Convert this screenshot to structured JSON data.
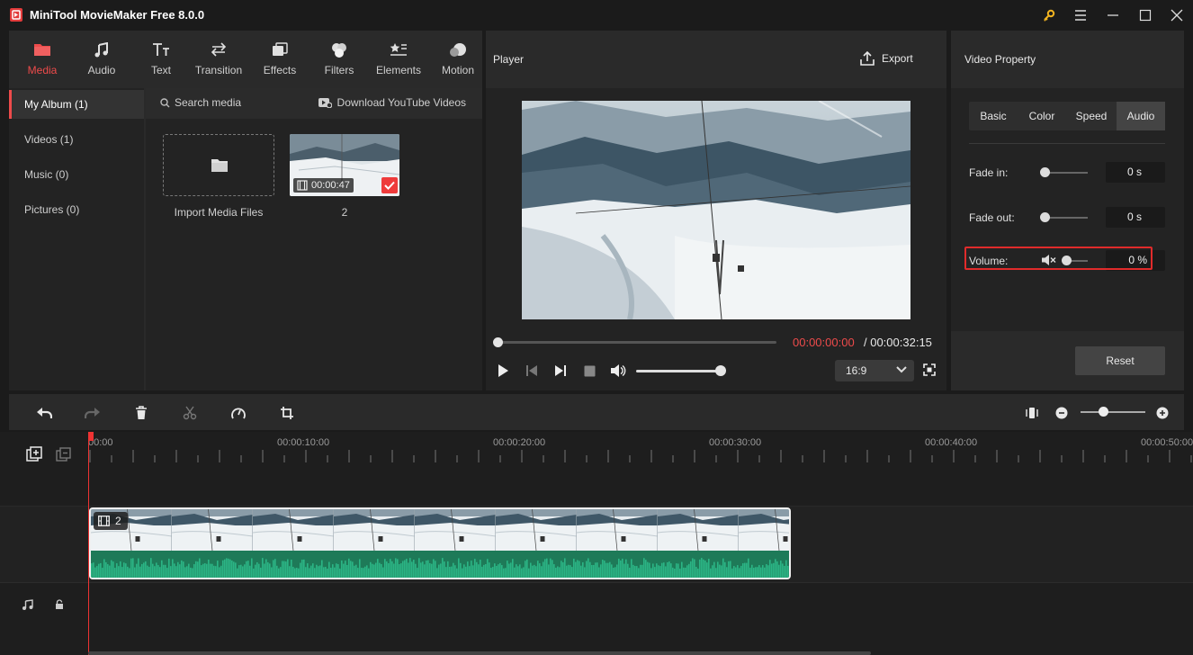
{
  "window": {
    "title": "MiniTool MovieMaker Free 8.0.0"
  },
  "toolbar": {
    "tabs": [
      {
        "label": "Media",
        "icon": "folder-icon",
        "active": true
      },
      {
        "label": "Audio",
        "icon": "music-note-icon"
      },
      {
        "label": "Text",
        "icon": "text-icon"
      },
      {
        "label": "Transition",
        "icon": "transition-arrows-icon"
      },
      {
        "label": "Effects",
        "icon": "effects-icon"
      },
      {
        "label": "Filters",
        "icon": "filters-icon"
      },
      {
        "label": "Elements",
        "icon": "elements-icon"
      },
      {
        "label": "Motion",
        "icon": "motion-icon"
      }
    ]
  },
  "album": {
    "items": [
      {
        "label": "My Album (1)",
        "active": true
      },
      {
        "label": "Videos (1)"
      },
      {
        "label": "Music (0)"
      },
      {
        "label": "Pictures (0)"
      }
    ]
  },
  "media": {
    "search_placeholder": "Search media",
    "youtube_label": "Download YouTube Videos",
    "import_label": "Import Media Files",
    "clip": {
      "duration": "00:00:47",
      "name": "2"
    }
  },
  "player": {
    "title": "Player",
    "export_label": "Export",
    "time_current": "00:00:00:00",
    "time_total": "/ 00:00:32:15",
    "aspect_ratio": "16:9",
    "progress": 0,
    "volume": 1
  },
  "property": {
    "title": "Video Property",
    "tabs": [
      {
        "label": "Basic"
      },
      {
        "label": "Color"
      },
      {
        "label": "Speed"
      },
      {
        "label": "Audio",
        "active": true
      }
    ],
    "fade_in": {
      "label": "Fade in:",
      "value": "0 s"
    },
    "fade_out": {
      "label": "Fade out:",
      "value": "0 s"
    },
    "volume": {
      "label": "Volume:",
      "value": "0 %"
    },
    "reset_label": "Reset"
  },
  "timeline": {
    "ticks": [
      "00:00",
      "00:00:10:00",
      "00:00:20:00",
      "00:00:30:00",
      "00:00:40:00",
      "00:00:50:00"
    ],
    "clip_label": "2"
  },
  "colors": {
    "accent": "#ee4b4b",
    "audio_wave": "#2bb585",
    "highlight": "#e02b2b"
  }
}
